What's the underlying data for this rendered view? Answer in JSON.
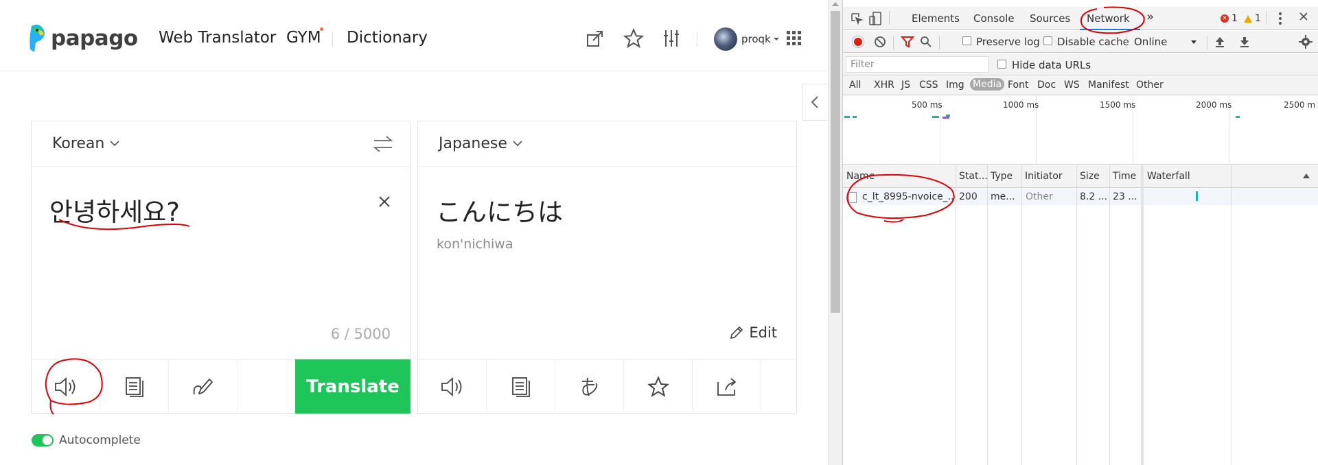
{
  "papago": {
    "logo_text": "papago",
    "nav": {
      "web_translator": "Web Translator",
      "gym": "GYM",
      "dictionary": "Dictionary"
    },
    "user": {
      "name": "proqk"
    },
    "source": {
      "language": "Korean",
      "text": "안녕하세요?",
      "counter": "6 / 5000",
      "translate_label": "Translate"
    },
    "target": {
      "language": "Japanese",
      "text": "こんにちは",
      "romanization": "kon'nichiwa",
      "edit_label": "Edit"
    },
    "autocomplete_label": "Autocomplete",
    "autocomplete_on": true,
    "colors": {
      "accent": "#1ec659",
      "gym_dot": "#ff6a3d",
      "annotation": "#e00000"
    }
  },
  "devtools": {
    "tabs": [
      "Elements",
      "Console",
      "Sources",
      "Network"
    ],
    "active_tab": "Network",
    "more_label": "»",
    "errors": "1",
    "warnings": "1",
    "toolbar": {
      "preserve_log": "Preserve log",
      "disable_cache": "Disable cache",
      "throttle": "Online"
    },
    "filter": {
      "placeholder": "Filter",
      "hide_data_urls": "Hide data URLs"
    },
    "types": [
      "All",
      "XHR",
      "JS",
      "CSS",
      "Img",
      "Media",
      "Font",
      "Doc",
      "WS",
      "Manifest",
      "Other"
    ],
    "active_type": "Media",
    "overview_ticks": [
      "500 ms",
      "1000 ms",
      "1500 ms",
      "2000 ms",
      "2500 m"
    ],
    "columns": [
      "Name",
      "Stat...",
      "Type",
      "Initiator",
      "Size",
      "Time",
      "Waterfall"
    ],
    "rows": [
      {
        "name": "c_lt_8995-nvoice_...",
        "status": "200",
        "type": "me...",
        "initiator": "Other",
        "size": "8.2 ...",
        "time": "23 ..."
      }
    ]
  }
}
